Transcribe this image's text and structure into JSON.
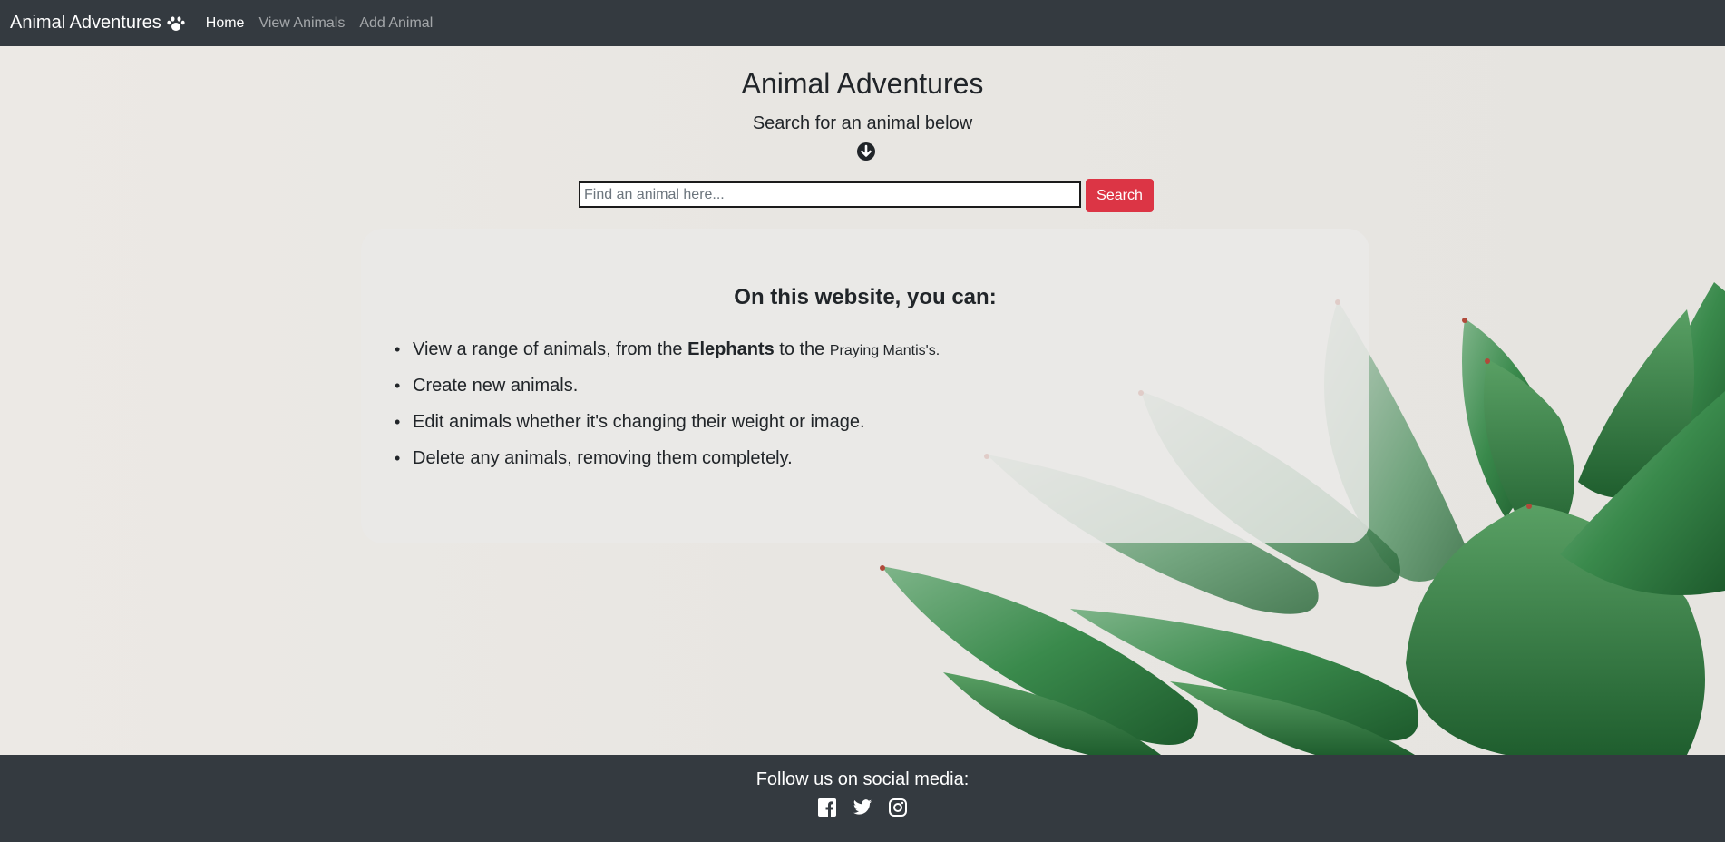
{
  "navbar": {
    "brand": "Animal Adventures",
    "brand_icon": "paw-icon",
    "links": [
      {
        "label": "Home",
        "active": true
      },
      {
        "label": "View Animals",
        "active": false
      },
      {
        "label": "Add Animal",
        "active": false
      }
    ]
  },
  "hero": {
    "title": "Animal Adventures",
    "subtitle": "Search for an animal below",
    "arrow_icon": "arrow-down-circle-icon"
  },
  "search": {
    "placeholder": "Find an animal here...",
    "value": "",
    "button_label": "Search",
    "button_color": "#dc3545"
  },
  "info": {
    "heading": "On this website, you can:",
    "item1": {
      "prefix": "View a range of animals, from the ",
      "bold": "Elephants",
      "middle": " to the ",
      "small": "Praying Mantis's."
    },
    "item2": "Create new animals.",
    "item3": "Edit animals whether it's changing their weight or image.",
    "item4": "Delete any animals, removing them completely."
  },
  "footer": {
    "text": "Follow us on social media:",
    "icons": [
      "facebook-icon",
      "twitter-icon",
      "instagram-icon"
    ]
  },
  "colors": {
    "navbar_bg": "#343a40",
    "footer_bg": "#343a40",
    "accent": "#dc3545"
  }
}
